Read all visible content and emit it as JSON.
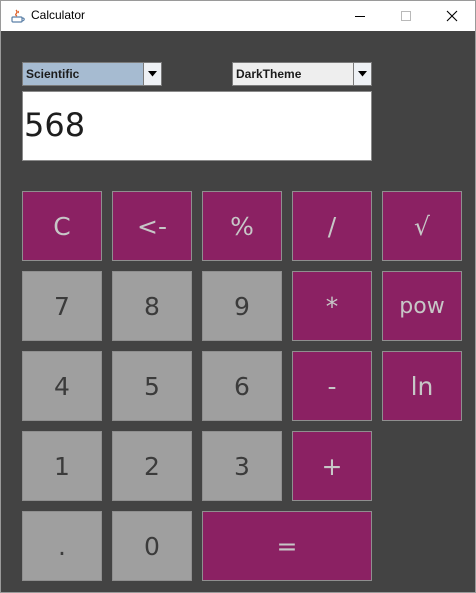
{
  "window": {
    "title": "Calculator"
  },
  "selectors": {
    "mode": "Scientific",
    "theme": "DarkTheme"
  },
  "display": {
    "value": "568"
  },
  "keys": {
    "clear": "C",
    "backspace": "<-",
    "percent": "%",
    "divide": "/",
    "sqrt": "√",
    "seven": "7",
    "eight": "8",
    "nine": "9",
    "multiply": "*",
    "pow": "pow",
    "four": "4",
    "five": "5",
    "six": "6",
    "minus": "-",
    "ln": "ln",
    "one": "1",
    "two": "2",
    "three": "3",
    "plus": "+",
    "dot": ".",
    "zero": "0",
    "equals": "="
  },
  "colors": {
    "background": "#434343",
    "operator_key": "#8b2163",
    "number_key": "#9f9f9f",
    "mode_selector": "#a6bbd1"
  }
}
